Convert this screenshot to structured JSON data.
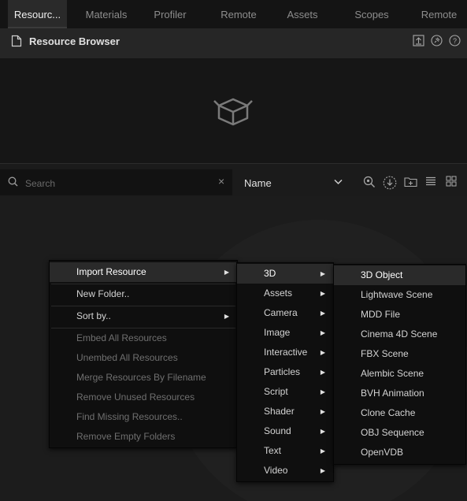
{
  "tabs": [
    "Resourc...",
    "Materials",
    "Profiler",
    "Remote",
    "Assets",
    "Scopes",
    "Remote"
  ],
  "panel": {
    "title": "Resource Browser",
    "icons": [
      "export-icon",
      "pin-icon",
      "help-icon"
    ]
  },
  "search": {
    "placeholder": "Search",
    "value": ""
  },
  "sort": {
    "selected": "Name"
  },
  "context_menu": {
    "items": [
      {
        "label": "Import Resource",
        "submenu": true,
        "highlighted": true
      },
      {
        "label": "New Folder..",
        "submenu": false
      },
      {
        "label": "Sort by..",
        "submenu": true
      },
      {
        "label": "Embed All Resources",
        "disabled": true
      },
      {
        "label": "Unembed All Resources",
        "disabled": true
      },
      {
        "label": "Merge Resources By Filename",
        "disabled": true
      },
      {
        "label": "Remove Unused Resources",
        "disabled": true
      },
      {
        "label": "Find Missing Resources..",
        "disabled": true
      },
      {
        "label": "Remove Empty Folders",
        "disabled": true
      }
    ]
  },
  "import_menu": {
    "items": [
      "3D",
      "Assets",
      "Camera",
      "Image",
      "Interactive",
      "Particles",
      "Script",
      "Shader",
      "Sound",
      "Text",
      "Video"
    ],
    "highlighted_index": 0
  },
  "threed_menu": {
    "items": [
      "3D Object",
      "Lightwave Scene",
      "MDD File",
      "Cinema 4D Scene",
      "FBX Scene",
      "Alembic Scene",
      "BVH Animation",
      "Clone Cache",
      "OBJ Sequence",
      "OpenVDB"
    ],
    "highlighted_index": 0
  },
  "colors": {
    "background": "#1b1b1b",
    "menu": "#0f0f0f",
    "highlight": "#2a2a2a"
  }
}
